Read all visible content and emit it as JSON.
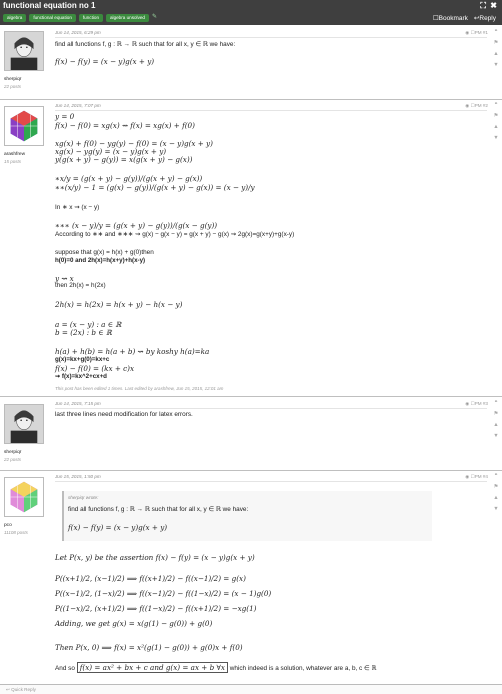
{
  "topbar": {
    "title": "functional equation no 1",
    "expand_icon": "⛶",
    "close_icon": "✖",
    "tags": [
      "algebra",
      "functional equation",
      "function",
      "algebra unsolved"
    ],
    "tag_edit_icon": "✎",
    "bookmark_label": "Bookmark",
    "reply_label": "Reply"
  },
  "posts": [
    {
      "id": "#1",
      "user": "sherpiqr",
      "post_count": "22 posts",
      "date": "Jun 14, 2015, 6:29 pm",
      "pm": "PM",
      "lines": [
        "find all functions f, g : ℝ → ℝ such that for all x, y ∈ ℝ we have:",
        "f(x) − f(y) = (x − y)g(x + y)"
      ]
    },
    {
      "id": "#2",
      "user": "arashfrew",
      "post_count": "15 posts",
      "date": "Jun 14, 2015, 7:07 pm",
      "pm": "PM",
      "lines": [
        "y = 0",
        "f(x) − f(0) = xg(x) ⇝ f(x) = xg(x) + f(0)",
        "xg(x) + f(0) − yg(y) − f(0) = (x − y)g(x + y)",
        "xg(x) − yg(y) = (x − y)g(x + y)",
        "y(g(x + y) − g(y)) = x(g(x + y) − g(x))",
        "∗x/y = (g(x + y) − g(y))/(g(x + y) − g(x))",
        "∗∗(x/y) − 1 = (g(x) − g(y))/(g(x + y) − g(x)) = (x − y)/y",
        "In ∗ x ⇝ (x − y)",
        "∗∗∗ (x − y)/y = (g(x + y) − g(y))/(g(x − g(y))",
        "According to ∗∗ and ∗∗∗ ⇝ g(x) − g(x − y) = g(x + y) − g(x) ⇝ 2g(x)=g(x+y)+g(x-y)",
        "suppose that g(x) = h(x) + g(0)then",
        "h(0)=0 and 2h(x)=h(x+y)+h(x-y)",
        "y ⇝ x",
        "then 2h(x) = h(2x)",
        "2h(x) = h(2x) = h(x + y) − h(x − y)",
        "a = (x − y) : a ∈ ℝ",
        "b = (2x) : b ∈ ℝ",
        "h(a) + h(b) = h(a + b) ⇝ by koshy h(a)=ka",
        "g(x)=kx+g(0)=kx+c",
        "f(x) − f(0) = (kx + c)x",
        "⇝ f(x)=kx^2+cx+d"
      ],
      "edited_note": "This post has been edited 1 times. Last edited by arashfrew, Jun 15, 2015, 12:01 am"
    },
    {
      "id": "#3",
      "user": "sherpiqr",
      "post_count": "22 posts",
      "date": "Jun 14, 2015, 7:15 pm",
      "pm": "PM",
      "lines": [
        "last three lines need modification for latex errors."
      ]
    },
    {
      "id": "#4",
      "user": "pco",
      "post_count": "11108 posts",
      "date": "Jun 15, 2015, 1:50 pm",
      "pm": "PM",
      "quote_author": "sherpiqr wrote:",
      "quote_text": "find all functions f, g : ℝ → ℝ such that for all x, y ∈ ℝ we have:",
      "quote_math": "f(x) − f(y) = (x − y)g(x + y)",
      "lines": [
        "Let P(x, y) be the assertion f(x) − f(y) = (x − y)g(x + y)",
        "P((x+1)/2, (x−1)/2) ⟹ f((x+1)/2) − f((x−1)/2) = g(x)",
        "P((x−1)/2, (1−x)/2) ⟹ f((x−1)/2) − f((1−x)/2) = (x − 1)g(0)",
        "P((1−x)/2, (x+1)/2) ⟹ f((1−x)/2) − f((x+1)/2) = −xg(1)",
        "Adding, we get g(x) = x(g(1) − g(0)) + g(0)",
        "Then P(x, 0) ⟹ f(x) = x²(g(1) − g(0)) + g(0)x + f(0)",
        "And so",
        "f(x) = ax² + bx + c and g(x) = ax + b ∀x",
        "which indeed is a solution, whatever are a, b, c ∈ ℝ"
      ]
    }
  ],
  "quick_reply": "Quick Reply",
  "side_icons": [
    "quote-icon",
    "flag-icon",
    "thumbs-up-icon",
    "thumbs-down-icon"
  ]
}
